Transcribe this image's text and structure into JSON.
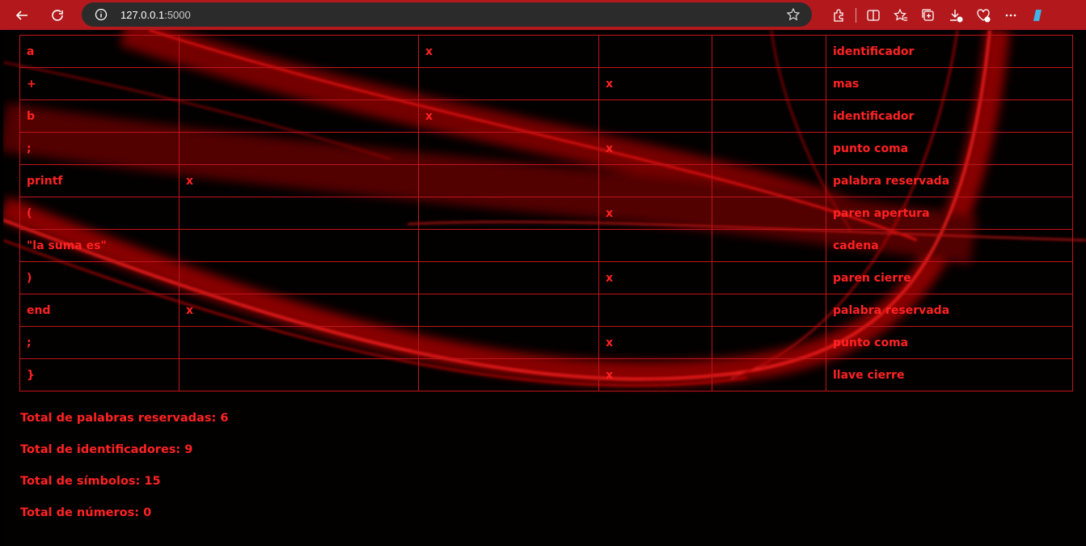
{
  "browser": {
    "url_host": "127.0.0.1",
    "url_port": ":5000"
  },
  "table": {
    "rows": [
      [
        "a",
        "",
        "x",
        "",
        "",
        "identificador"
      ],
      [
        "+",
        "",
        "",
        "x",
        "",
        "mas"
      ],
      [
        "b",
        "",
        "x",
        "",
        "",
        "identificador"
      ],
      [
        ";",
        "",
        "",
        "x",
        "",
        "punto coma"
      ],
      [
        "printf",
        "x",
        "",
        "",
        "",
        "palabra reservada"
      ],
      [
        "(",
        "",
        "",
        "x",
        "",
        "paren apertura"
      ],
      [
        "\"la suma es\"",
        "",
        "",
        "",
        "",
        "cadena"
      ],
      [
        ")",
        "",
        "",
        "x",
        "",
        "paren cierre"
      ],
      [
        "end",
        "x",
        "",
        "",
        "",
        "palabra reservada"
      ],
      [
        ";",
        "",
        "",
        "x",
        "",
        "punto coma"
      ],
      [
        "}",
        "",
        "",
        "x",
        "",
        "llave cierre"
      ]
    ]
  },
  "totals": {
    "reserved": "Total de palabras reservadas: 6",
    "identifiers": "Total de identificadores: 9",
    "symbols": "Total de símbolos: 15",
    "numbers": "Total de números: 0"
  },
  "colors": {
    "accent": "#ff2222",
    "toolbar": "#b3191c",
    "background": "#000000"
  }
}
